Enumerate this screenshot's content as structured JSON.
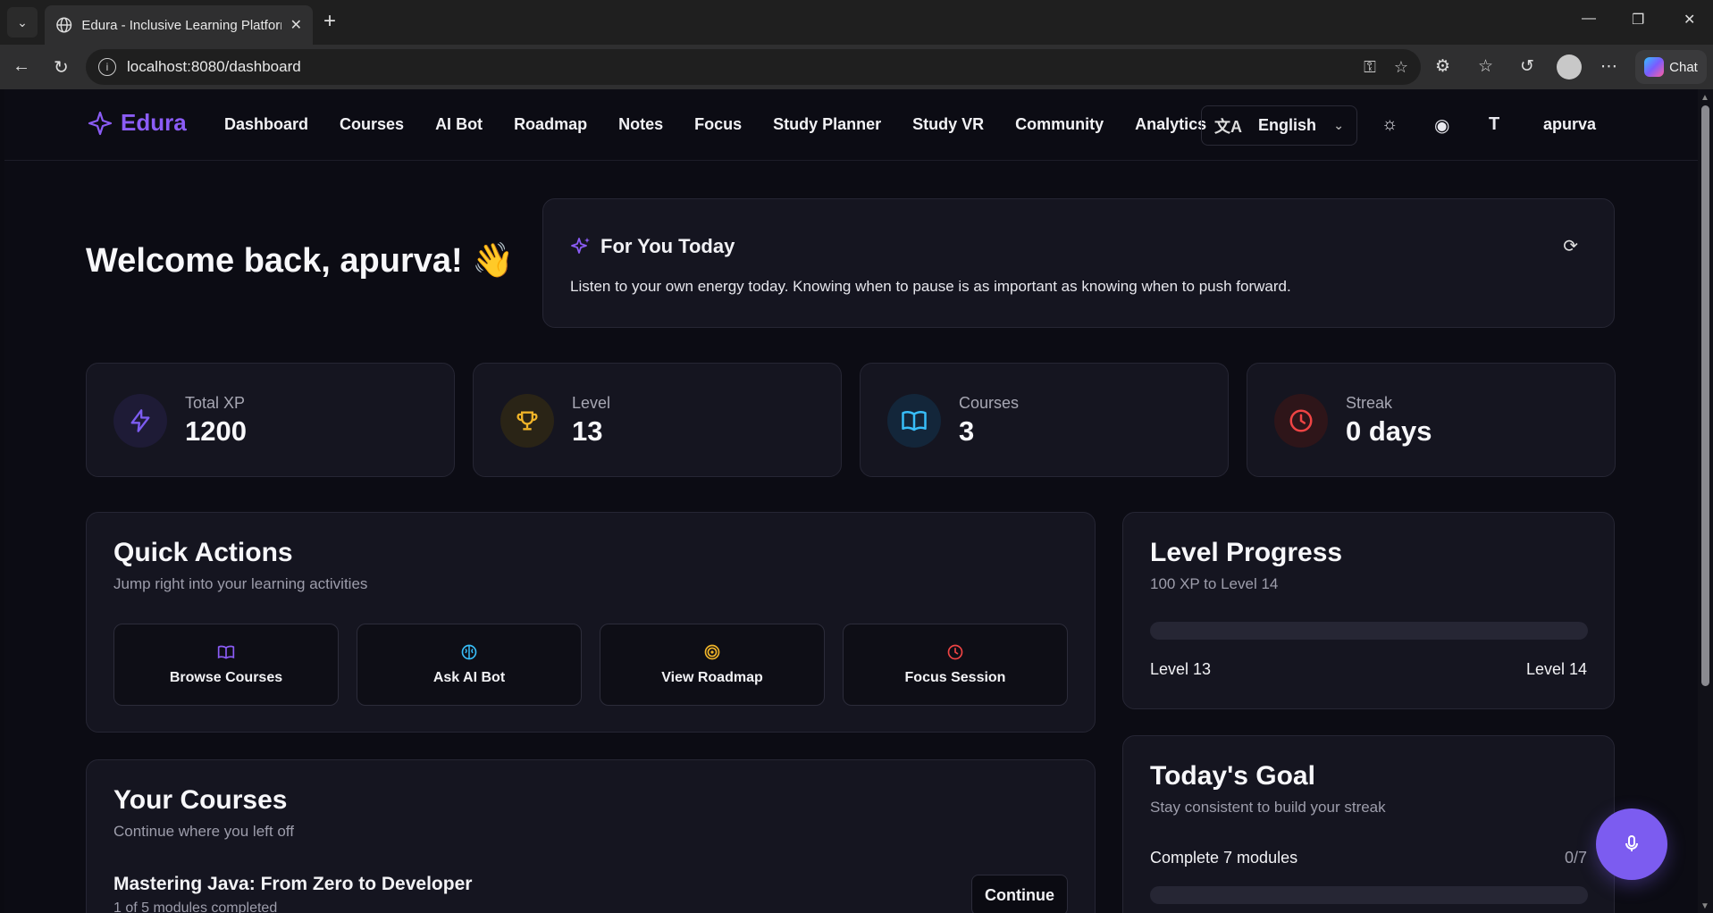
{
  "browser": {
    "tab_title": "Edura - Inclusive Learning Platform",
    "url": "localhost:8080/dashboard",
    "chat_label": "Chat"
  },
  "header": {
    "brand": "Edura",
    "nav": [
      "Dashboard",
      "Courses",
      "AI Bot",
      "Roadmap",
      "Notes",
      "Focus",
      "Study Planner",
      "Study VR",
      "Community",
      "Analytics"
    ],
    "language": "English",
    "user": "apurva",
    "icons": [
      "translate-icon",
      "sun-icon",
      "eye-icon",
      "text-size-icon"
    ]
  },
  "welcome": {
    "text": "Welcome back, apurva! 👋"
  },
  "for_you": {
    "title": "For You Today",
    "message": "Listen to your own energy today. Knowing when to pause is as important as knowing when to push forward."
  },
  "stats": [
    {
      "label": "Total XP",
      "value": "1200",
      "icon": "lightning-icon",
      "color": "#7c5cf0",
      "bg": "#1e1b36"
    },
    {
      "label": "Level",
      "value": "13",
      "icon": "trophy-icon",
      "color": "#f0b429",
      "bg": "#2a2416"
    },
    {
      "label": "Courses",
      "value": "3",
      "icon": "book-open-icon",
      "color": "#38bdf8",
      "bg": "#13263a"
    },
    {
      "label": "Streak",
      "value": "0 days",
      "icon": "clock-icon",
      "color": "#ef4444",
      "bg": "#2e1519"
    }
  ],
  "quick_actions": {
    "title": "Quick Actions",
    "subtitle": "Jump right into your learning activities",
    "items": [
      {
        "label": "Browse Courses",
        "icon": "book-icon",
        "color": "#8b5cf6"
      },
      {
        "label": "Ask AI Bot",
        "icon": "brain-icon",
        "color": "#38bdf8"
      },
      {
        "label": "View Roadmap",
        "icon": "target-icon",
        "color": "#f0b429"
      },
      {
        "label": "Focus Session",
        "icon": "clock-icon",
        "color": "#ef4444"
      }
    ]
  },
  "level_progress": {
    "title": "Level Progress",
    "subtitle": "100 XP to Level 14",
    "progress_fraction": 0.0,
    "from_label": "Level 13",
    "to_label": "Level 14"
  },
  "your_courses": {
    "title": "Your Courses",
    "subtitle": "Continue where you left off",
    "course_name": "Mastering Java: From Zero to Developer",
    "course_progress": "1 of 5 modules completed",
    "continue_label": "Continue"
  },
  "todays_goal": {
    "title": "Today's Goal",
    "subtitle": "Stay consistent to build your streak",
    "task": "Complete 7 modules",
    "count": "0/7"
  },
  "colors": {
    "accent": "#8b5cf6",
    "fab": "#7c5cf0"
  }
}
